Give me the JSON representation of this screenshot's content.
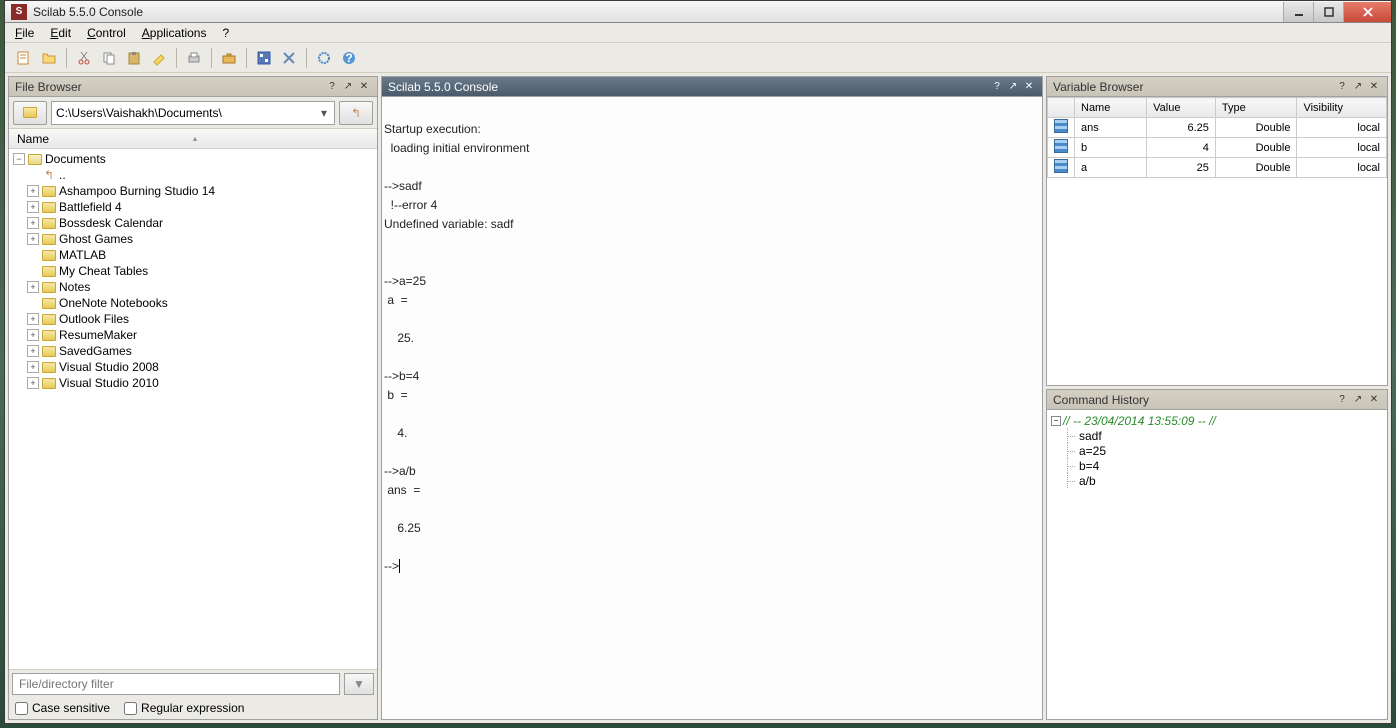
{
  "titlebar": {
    "title": "Scilab 5.5.0 Console"
  },
  "menubar": {
    "file": "File",
    "edit": "Edit",
    "control": "Control",
    "applications": "Applications",
    "help": "?"
  },
  "file_browser": {
    "title": "File Browser",
    "path": "C:\\Users\\Vaishakh\\Documents\\",
    "name_header": "Name",
    "root": "Documents",
    "items": [
      "..",
      "Ashampoo Burning Studio 14",
      "Battlefield 4",
      "Bossdesk Calendar",
      "Ghost Games",
      "MATLAB",
      "My Cheat Tables",
      "Notes",
      "OneNote Notebooks",
      "Outlook Files",
      "ResumeMaker",
      "SavedGames",
      "Visual Studio 2008",
      "Visual Studio 2010"
    ],
    "expandable": [
      false,
      true,
      true,
      true,
      true,
      false,
      false,
      true,
      false,
      true,
      true,
      true,
      true,
      true
    ],
    "filter_placeholder": "File/directory filter",
    "case_sensitive_label": "Case sensitive",
    "regex_label": "Regular expression"
  },
  "console": {
    "title": "Scilab 5.5.0 Console",
    "content": "\nStartup execution:\n  loading initial environment\n\n-->sadf\n  !--error 4\nUndefined variable: sadf\n\n\n-->a=25\n a  =\n \n    25.\n\n-->b=4\n b  =\n \n    4.\n\n-->a/b\n ans  =\n \n    6.25\n\n-->"
  },
  "variable_browser": {
    "title": "Variable Browser",
    "columns": {
      "name": "Name",
      "value": "Value",
      "type": "Type",
      "visibility": "Visibility"
    },
    "rows": [
      {
        "name": "ans",
        "value": "6.25",
        "type": "Double",
        "visibility": "local"
      },
      {
        "name": "b",
        "value": "4",
        "type": "Double",
        "visibility": "local"
      },
      {
        "name": "a",
        "value": "25",
        "type": "Double",
        "visibility": "local"
      }
    ]
  },
  "command_history": {
    "title": "Command History",
    "timestamp": "// -- 23/04/2014 13:55:09 -- //",
    "items": [
      "sadf",
      "a=25",
      "b=4",
      "a/b"
    ]
  }
}
